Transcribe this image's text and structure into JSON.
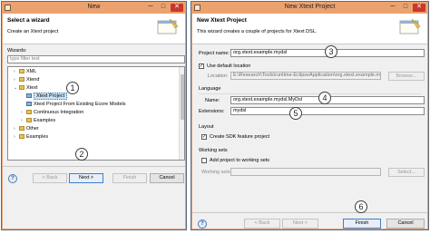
{
  "left_window": {
    "title": "New",
    "banner_title": "Select a wizard",
    "banner_desc": "Create an Xtext project",
    "wizards_label": "Wizards:",
    "filter_placeholder": "type filter text",
    "tree": [
      {
        "label": "XML",
        "twisty": "›",
        "icon": "folder"
      },
      {
        "label": "Xtend",
        "twisty": "›",
        "icon": "folder"
      },
      {
        "label": "Xtext",
        "twisty": "⌄",
        "icon": "folder"
      },
      {
        "label": "Xtext Project",
        "twisty": "",
        "icon": "wizard",
        "selected": true
      },
      {
        "label": "Xtext Project From Existing Ecore Models",
        "twisty": "",
        "icon": "wizard"
      },
      {
        "label": "Continuous Integration",
        "twisty": "›",
        "icon": "folder"
      },
      {
        "label": "Examples",
        "twisty": "›",
        "icon": "folder"
      },
      {
        "label": "Other",
        "twisty": "›",
        "icon": "folder"
      },
      {
        "label": "Examples",
        "twisty": "›",
        "icon": "folder"
      }
    ],
    "buttons": {
      "help": "?",
      "back": "< Back",
      "next": "Next >",
      "finish": "Finish",
      "cancel": "Cancel"
    }
  },
  "right_window": {
    "title": "New Xtext Project",
    "banner_title": "New Xtext Project",
    "banner_desc": "This wizard creates a couple of projects for Xtext DSL.",
    "project_name_label": "Project name:",
    "project_name_value": "org.xtext.example.mydsl",
    "use_default_location_label": "Use default location",
    "use_default_location_checked": true,
    "location_label": "Location:",
    "location_value": "E:\\Research\\Tools\\runtime-EclipseApplication\\org.xtext.example.mydsl",
    "browse_label": "Browse...",
    "language_group": "Language",
    "name_label": "Name:",
    "name_value": "org.xtext.example.mydsl.MyDsl",
    "extensions_label": "Extensions:",
    "extensions_value": "mydsl",
    "layout_group": "Layout",
    "create_sdk_label": "Create SDK feature project",
    "create_sdk_checked": true,
    "working_sets_group": "Working sets",
    "add_working_sets_label": "Add project to working sets",
    "add_working_sets_checked": false,
    "working_sets_label": "Working sets:",
    "select_label": "Select...",
    "buttons": {
      "help": "?",
      "back": "< Back",
      "next": "Next >",
      "finish": "Finish",
      "cancel": "Cancel"
    }
  },
  "callouts": [
    "1",
    "2",
    "3",
    "4",
    "5",
    "6"
  ],
  "colors": {
    "titlebar": "#eba26f",
    "close_button": "#c7382d",
    "selection": "#cce4f7",
    "default_button_border": "#3c7fd0"
  }
}
